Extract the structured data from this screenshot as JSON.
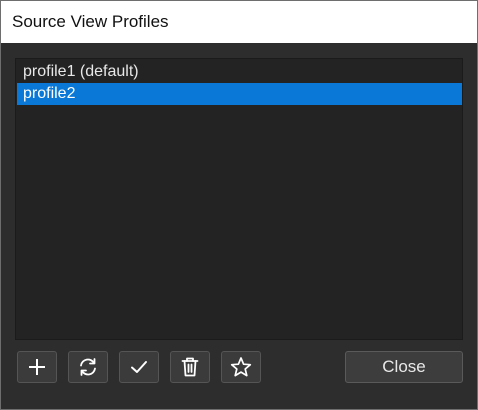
{
  "window": {
    "title": "Source View Profiles"
  },
  "profiles": {
    "items": [
      {
        "label": "profile1 (default)",
        "selected": false
      },
      {
        "label": "profile2",
        "selected": true
      }
    ]
  },
  "toolbar": {
    "add_icon": "plus-icon",
    "refresh_icon": "refresh-icon",
    "apply_icon": "checkmark-icon",
    "delete_icon": "trash-icon",
    "default_icon": "star-icon",
    "close_label": "Close"
  },
  "colors": {
    "selection": "#0a78d7",
    "background": "#2d2d2d",
    "list_background": "#232323",
    "titlebar": "#ffffff"
  }
}
